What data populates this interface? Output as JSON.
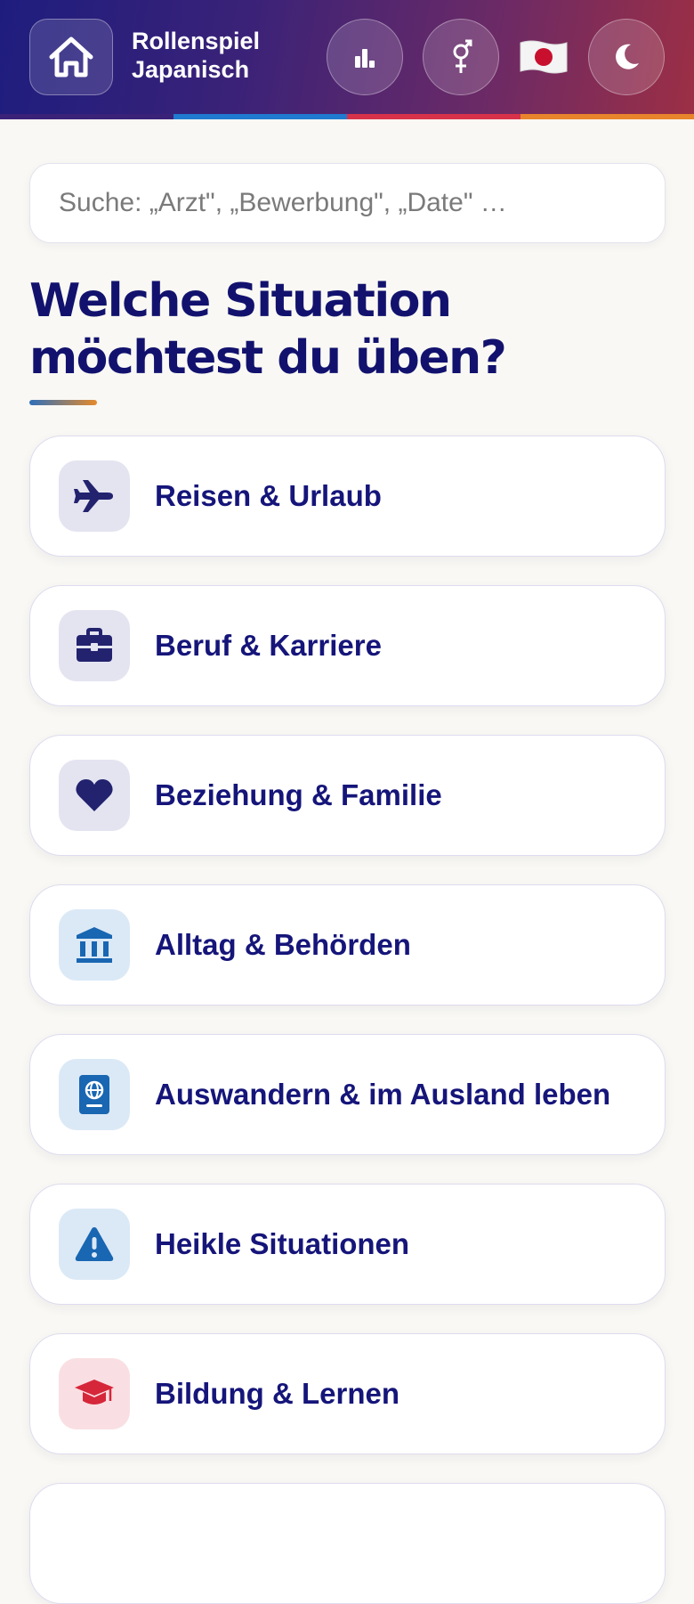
{
  "header": {
    "title_line1": "Rollenspiel",
    "title_line2": "Japanisch",
    "stripe_colors": [
      "#3a2278",
      "#1f7ad0",
      "#d8324a",
      "#e8842c"
    ],
    "flag": "🇯🇵"
  },
  "search": {
    "placeholder": "Suche: „Arzt\", „Bewerbung\", „Date\" …",
    "value": ""
  },
  "heading": "Welche Situation möchtest du üben?",
  "categories": [
    {
      "label": "Reisen & Urlaub",
      "icon": "airplane-icon",
      "color": "#22226f",
      "bg": "#e4e4f1"
    },
    {
      "label": "Beruf & Karriere",
      "icon": "briefcase-icon",
      "color": "#22226f",
      "bg": "#e4e4f1"
    },
    {
      "label": "Beziehung & Familie",
      "icon": "heart-icon",
      "color": "#22226f",
      "bg": "#e4e4f1"
    },
    {
      "label": "Alltag & Behörden",
      "icon": "government-building-icon",
      "color": "#1966b2",
      "bg": "#dbe9f6"
    },
    {
      "label": "Auswandern & im Ausland leben",
      "icon": "passport-icon",
      "color": "#1966b2",
      "bg": "#dbe9f6"
    },
    {
      "label": "Heikle Situationen",
      "icon": "warning-icon",
      "color": "#1966b2",
      "bg": "#dbe9f6"
    },
    {
      "label": "Bildung & Lernen",
      "icon": "graduation-cap-icon",
      "color": "#d6263a",
      "bg": "#f9dfe3"
    },
    {
      "label": "",
      "icon": "",
      "color": "#22226f",
      "bg": "#ffffff"
    }
  ]
}
